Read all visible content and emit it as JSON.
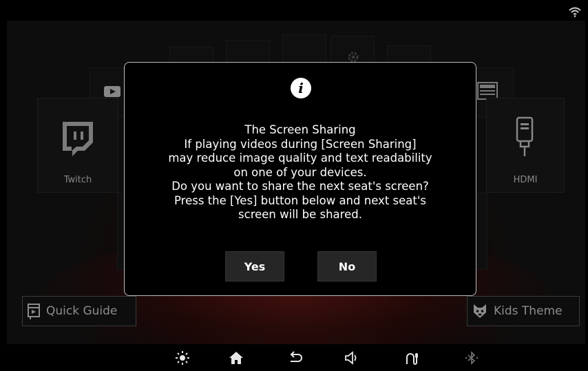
{
  "apps": {
    "twitch": {
      "label": "Twitch"
    },
    "hdmi": {
      "label": "HDMI"
    }
  },
  "bottom": {
    "quick_guide": "Quick Guide",
    "kids_theme": "Kids Theme"
  },
  "dialog": {
    "lines": [
      "The Screen Sharing",
      "If playing videos during [Screen Sharing]",
      "may reduce image quality and text readability",
      "on one of your devices.",
      "Do you want to share the next seat's screen?",
      "Press the [Yes] button below and next seat's",
      "screen will be shared."
    ],
    "info_glyph": "i",
    "yes": "Yes",
    "no": "No"
  },
  "navbar": {
    "icons": [
      "moon-icon",
      "brightness-icon",
      "home-icon",
      "back-icon",
      "volume-icon",
      "voice-assistant-icon",
      "bluetooth-icon"
    ]
  },
  "colors": {
    "dialog_bg": "#000000",
    "dialog_border": "#bdbdbd",
    "button_bg": "#262626",
    "glow": "#962019"
  }
}
